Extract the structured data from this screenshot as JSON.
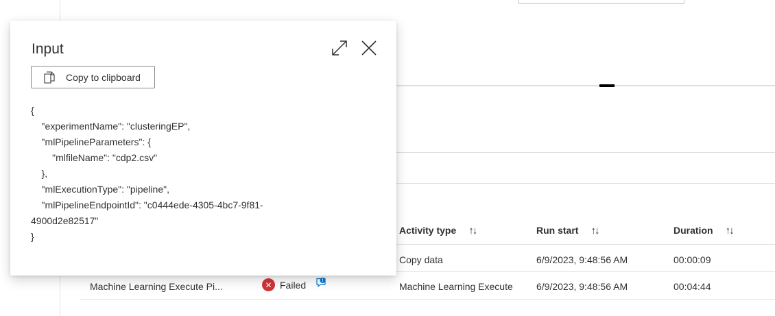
{
  "popup": {
    "title": "Input",
    "copy_label": "Copy to clipboard",
    "json_lines": [
      "{",
      "    \"experimentName\": \"clusteringEP\",",
      "    \"mlPipelineParameters\": {",
      "        \"mlfileName\": \"cdp2.csv\"",
      "    },",
      "    \"mlExecutionType\": \"pipeline\",",
      "    \"mlPipelineEndpointId\": \"c0444ede-4305-4bc7-9f81-",
      "4900d2e82517\"",
      "}"
    ]
  },
  "table": {
    "headers": {
      "activity_type": "Activity type",
      "run_start": "Run start",
      "duration": "Duration"
    },
    "rows": [
      {
        "activity_type": "Copy data",
        "run_start": "6/9/2023, 9:48:56 AM",
        "duration": "00:00:09"
      },
      {
        "name": "Machine Learning Execute Pi...",
        "status": "Failed",
        "activity_type": "Machine Learning Execute",
        "run_start": "6/9/2023, 9:48:56 AM",
        "duration": "00:04:44"
      }
    ]
  },
  "icons": {
    "copy": "copy-icon",
    "expand": "expand-icon",
    "close": "close-icon",
    "sort": "sort-icon",
    "failed": "failed-icon",
    "message": "message-icon"
  },
  "colors": {
    "failed": "#d13438",
    "info": "#0078d4",
    "divider": "#e1dfdd"
  }
}
